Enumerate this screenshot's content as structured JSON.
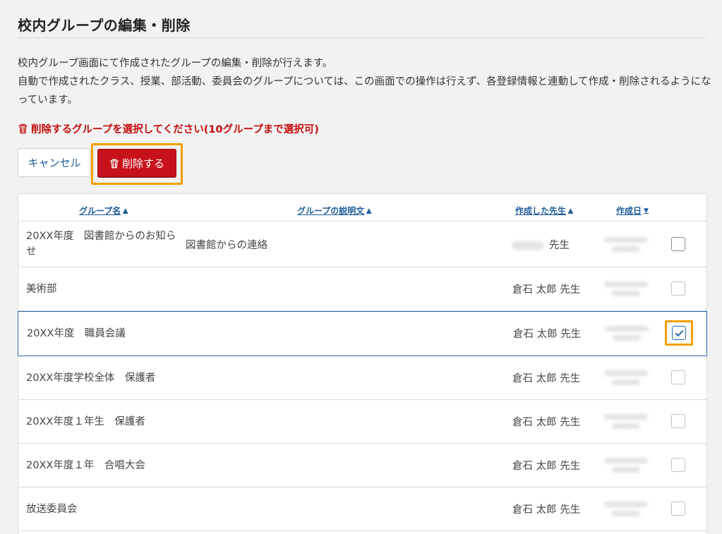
{
  "page": {
    "title": "校内グループの編集・削除",
    "description_line1": "校内グループ画面にて作成されたグループの編集・削除が行えます。",
    "description_line2": "自動で作成されたクラス、授業、部活動、委員会のグループについては、この画面での操作は行えず、各登録情報と連動して作成・削除されるようになっています。"
  },
  "notice": {
    "icon": "trash-icon",
    "text": "削除するグループを選択してください(10グループまで選択可)",
    "color": "#c40f0f"
  },
  "actions": {
    "cancel_label": "キャンセル",
    "delete_label": "削除する",
    "delete_color": "#c8121b",
    "highlight_color": "#f0a000"
  },
  "table": {
    "columns": [
      {
        "label": "グループ名",
        "sort": "asc"
      },
      {
        "label": "グループの説明文",
        "sort": "asc"
      },
      {
        "label": "作成した先生",
        "sort": "asc"
      },
      {
        "label": "作成日",
        "sort": "desc"
      }
    ],
    "rows": [
      {
        "name": "20XX年度　図書館からのお知らせ",
        "description": "図書館からの連絡",
        "author": "先生",
        "author_blurred": true,
        "checked": false
      },
      {
        "name": "美術部",
        "description": "",
        "author": "倉石 太郎 先生",
        "author_blurred": false,
        "checked": false
      },
      {
        "name": "20XX年度　職員会議",
        "description": "",
        "author": "倉石 太郎 先生",
        "author_blurred": false,
        "checked": true
      },
      {
        "name": "20XX年度学校全体　保護者",
        "description": "",
        "author": "倉石 太郎 先生",
        "author_blurred": false,
        "checked": false
      },
      {
        "name": "20XX年度１年生　保護者",
        "description": "",
        "author": "倉石 太郎 先生",
        "author_blurred": false,
        "checked": false
      },
      {
        "name": "20XX年度１年　合唱大会",
        "description": "",
        "author": "倉石 太郎 先生",
        "author_blurred": false,
        "checked": false
      },
      {
        "name": "放送委員会",
        "description": "",
        "author": "倉石 太郎 先生",
        "author_blurred": false,
        "checked": false
      }
    ]
  }
}
